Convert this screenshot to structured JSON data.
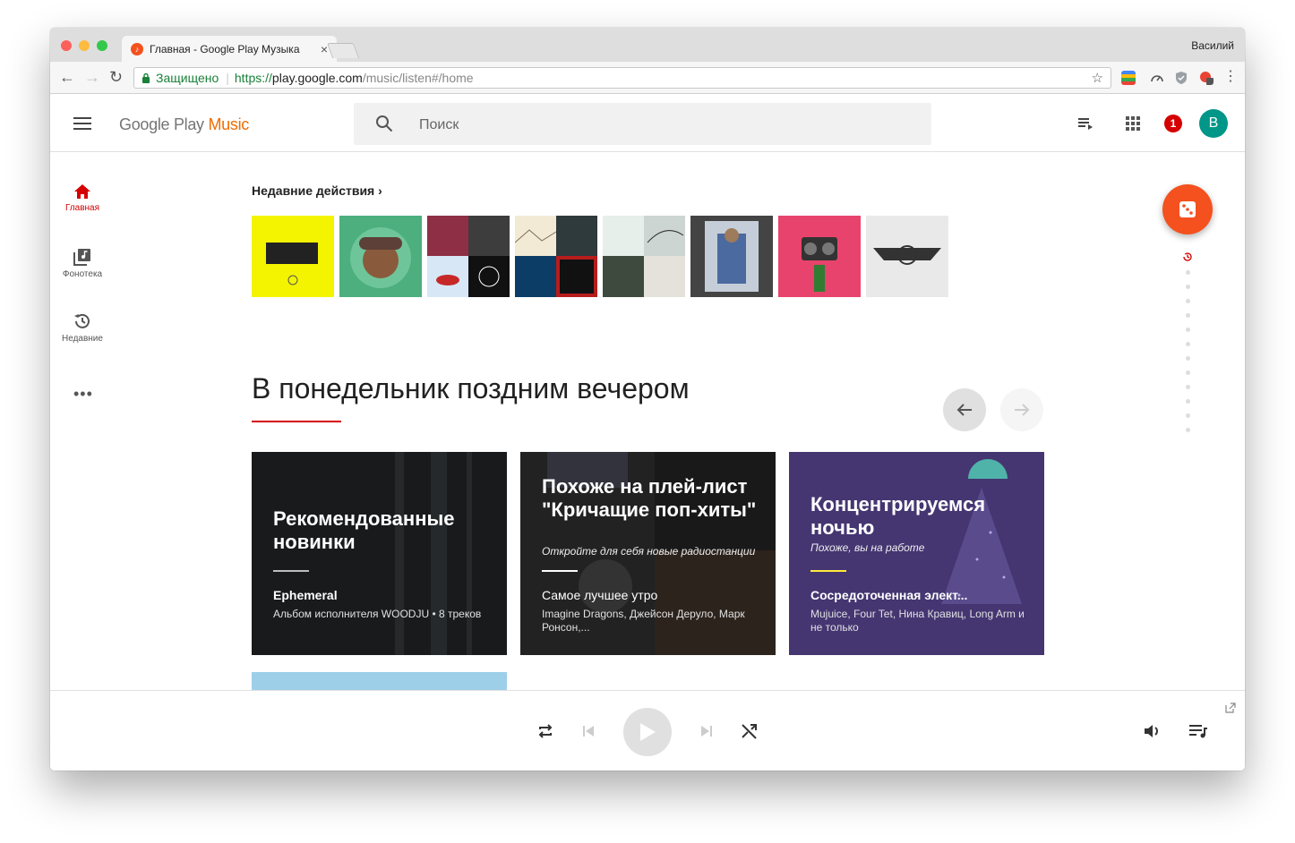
{
  "browser": {
    "tab_title": "Главная - Google Play Музыка",
    "tab_close": "×",
    "user_name": "Василий",
    "secure_label": "Защищено",
    "url_scheme": "https://",
    "url_host": "play.google.com",
    "url_path": "/music/listen#/home"
  },
  "header": {
    "logo_main": "Google Play ",
    "logo_accent": "Music",
    "search_placeholder": "Поиск",
    "notification_count": "1",
    "avatar_letter": "В"
  },
  "sidebar": {
    "items": [
      {
        "label": "Главная"
      },
      {
        "label": "Фонотека"
      },
      {
        "label": "Недавние"
      }
    ],
    "more": "•••"
  },
  "recent": {
    "heading": "Недавние действия",
    "thumbs": [
      {
        "color": "#f4f400",
        "name": "album-thumb-1"
      },
      {
        "color": "#4caf7d",
        "name": "album-thumb-2"
      },
      {
        "color": "#6a2c3a",
        "name": "album-thumb-3"
      },
      {
        "color": "#7d8a8f",
        "name": "album-thumb-4"
      },
      {
        "color": "#5c6b66",
        "name": "album-thumb-5"
      },
      {
        "color": "#444444",
        "name": "album-thumb-6"
      },
      {
        "color": "#e8436c",
        "name": "album-thumb-7"
      },
      {
        "color": "#e9e9ea",
        "name": "album-thumb-8"
      }
    ]
  },
  "section": {
    "title": "В понедельник поздним вечером"
  },
  "cards": [
    {
      "title": "Рекомендованные новинки",
      "subtitle": "",
      "name": "Ephemeral",
      "desc": "Альбом исполнителя WOODJU • 8 треков",
      "bg": "#272a2c",
      "line": "#bdbdbd"
    },
    {
      "title": "Похоже на плей-лист \"Кричащие поп-хиты\"",
      "subtitle": "Откройте для себя новые радиостанции",
      "name": "Самое лучшее утро",
      "desc": "Imagine Dragons, Джейсон Деруло, Марк Ронсон,...",
      "bg": "#2b2b2b",
      "line": "#ffffff"
    },
    {
      "title": "Концентрируемся ночью",
      "subtitle": "Похоже, вы на работе",
      "name": "Сосредоточенная элект...",
      "desc": "Mujuice, Four Tet, Нина Кравиц, Long Arm и не только",
      "bg": "#4a3878",
      "line": "#ffeb3b"
    }
  ]
}
